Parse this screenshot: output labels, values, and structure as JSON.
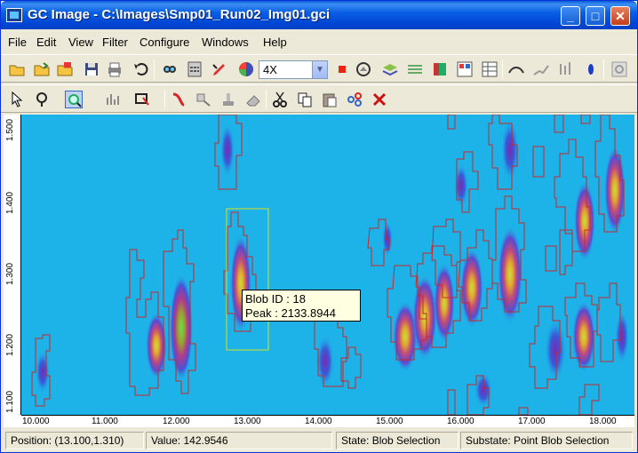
{
  "window": {
    "title": "GC Image - C:\\Images\\Smp01_Run02_Img01.gci",
    "minimize_label": "_",
    "maximize_label": "□",
    "close_label": "✕"
  },
  "menu": [
    "File",
    "Edit",
    "View",
    "Filter",
    "Configure",
    "Windows",
    "Help"
  ],
  "toolbar1": {
    "zoom_value": "4X",
    "icons": [
      "open-icon",
      "open-folder-icon",
      "open-image-icon",
      "save-icon",
      "print-icon",
      "undo-icon",
      "find-icon",
      "calculator-icon",
      "edit-pen-icon",
      "colorwheel-icon",
      "stop-icon",
      "hand-icon",
      "layers-icon",
      "lines-icon",
      "book-icon",
      "chart-table-icon",
      "table-icon",
      "view3d-icon",
      "graph3d-icon",
      "peaks-icon",
      "blob-icon",
      "rotate-icon"
    ]
  },
  "toolbar2": {
    "icons": [
      "pointer-icon",
      "lasso-icon",
      "zoom-select-icon",
      "histogram-icon",
      "filter-icon",
      "template-icon",
      "transform-icon",
      "stamp-icon",
      "eraser-icon",
      "cut-icon",
      "copy-icon",
      "paste-icon",
      "group-icon",
      "delete-icon"
    ]
  },
  "plot": {
    "x_ticks": [
      "10.000",
      "11.000",
      "12.000",
      "13.000",
      "14.000",
      "15.000",
      "16.000",
      "17.000",
      "18.000"
    ],
    "y_ticks": [
      "1.500",
      "1.400",
      "1.300",
      "1.200",
      "1.100"
    ],
    "background_color": "#1db2e8",
    "outline_color": "#c8282a",
    "selection_color": "#d6e21a"
  },
  "tooltip": {
    "line1": "Blob ID : 18",
    "line2": "Peak : 2133.8944"
  },
  "status": {
    "position": "Position: (13.100,1.310)",
    "value": "Value: 142.9546",
    "state": "State: Blob Selection",
    "substate": "Substate: Point Blob Selection"
  }
}
